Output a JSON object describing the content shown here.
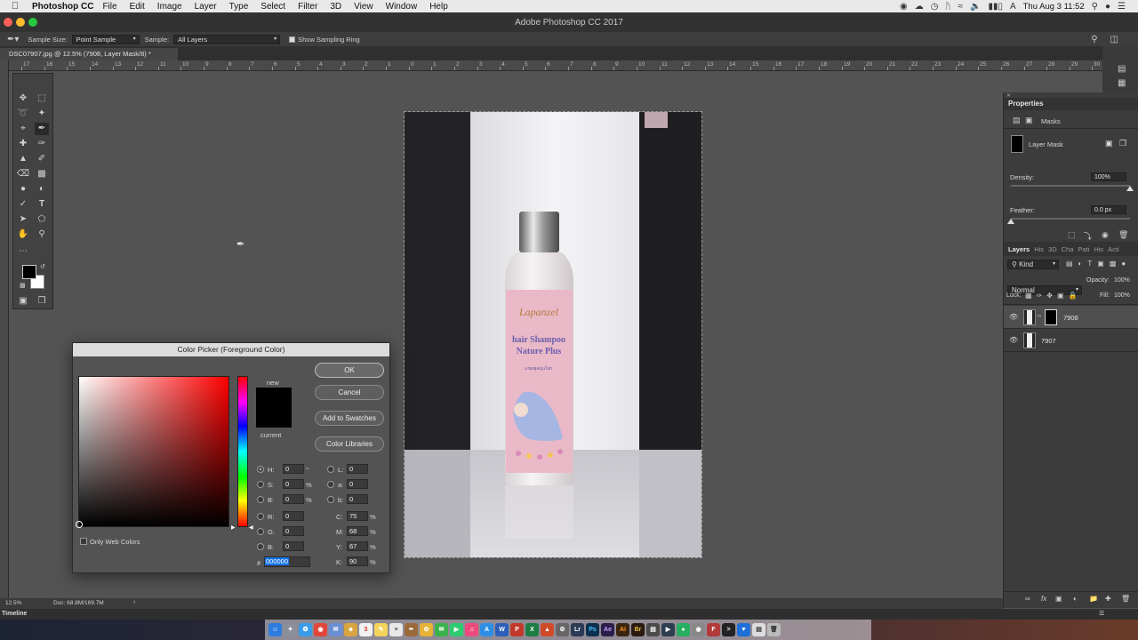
{
  "menubar": {
    "app": "Photoshop CC",
    "items": [
      "File",
      "Edit",
      "Image",
      "Layer",
      "Type",
      "Select",
      "Filter",
      "3D",
      "View",
      "Window",
      "Help"
    ],
    "clock": "Thu Aug 3  11:52"
  },
  "window": {
    "title": "Adobe Photoshop CC 2017"
  },
  "options": {
    "sample_size_label": "Sample Size:",
    "sample_size_value": "Point Sample",
    "sample_label": "Sample:",
    "sample_value": "All Layers",
    "sampling_ring_label": "Show Sampling Ring"
  },
  "document": {
    "tab_title": "DSC07907.jpg @ 12.5% (7908, Layer Mask/8) *",
    "ruler_ticks": [
      "17",
      "16",
      "15",
      "14",
      "13",
      "12",
      "11",
      "10",
      "9",
      "8",
      "7",
      "6",
      "5",
      "4",
      "3",
      "2",
      "1",
      "0",
      "1",
      "2",
      "3",
      "4",
      "5",
      "6",
      "7",
      "8",
      "9",
      "10",
      "11",
      "12",
      "13",
      "14",
      "15",
      "16",
      "17",
      "18",
      "19",
      "20",
      "21",
      "22",
      "23",
      "24",
      "25",
      "26",
      "27",
      "28",
      "29",
      "30"
    ]
  },
  "status": {
    "zoom": "12.5%",
    "doc": "Doc: 68.8M/169.7M"
  },
  "timeline": {
    "label": "Timeline"
  },
  "properties": {
    "title": "Properties",
    "masks_label": "Masks",
    "layer_mask_label": "Layer Mask",
    "density_label": "Density:",
    "density_value": "100%",
    "density_level": 1.0,
    "feather_label": "Feather:",
    "feather_value": "0.0 px",
    "feather_level": 0.0
  },
  "layers": {
    "tabs": [
      "Layers",
      "His",
      "3D",
      "Cha",
      "Pati",
      "His",
      "Acti"
    ],
    "kind_label": "Kind",
    "blend_mode": "Normal",
    "opacity_label": "Opacity:",
    "opacity_value": "100%",
    "lock_label": "Lock:",
    "fill_label": "Fill:",
    "fill_value": "100%",
    "rows": [
      {
        "name": "7908"
      },
      {
        "name": "7907"
      }
    ]
  },
  "dialog": {
    "title": "Color Picker (Foreground Color)",
    "ok": "OK",
    "cancel": "Cancel",
    "add_swatches": "Add to Swatches",
    "color_libraries": "Color Libraries",
    "new_label": "new",
    "current_label": "current",
    "only_web": "Only Web Colors",
    "fields": {
      "H": {
        "label": "H:",
        "value": "0",
        "unit": "°"
      },
      "S": {
        "label": "S:",
        "value": "0",
        "unit": "%"
      },
      "B": {
        "label": "B:",
        "value": "0",
        "unit": "%"
      },
      "R": {
        "label": "R:",
        "value": "0",
        "unit": ""
      },
      "G": {
        "label": "G:",
        "value": "0",
        "unit": ""
      },
      "Bb": {
        "label": "B:",
        "value": "0",
        "unit": ""
      },
      "L": {
        "label": "L:",
        "value": "0",
        "unit": ""
      },
      "a": {
        "label": "a:",
        "value": "0",
        "unit": ""
      },
      "b": {
        "label": "b:",
        "value": "0",
        "unit": ""
      },
      "C": {
        "label": "C:",
        "value": "75",
        "unit": "%"
      },
      "M": {
        "label": "M:",
        "value": "68",
        "unit": "%"
      },
      "Y": {
        "label": "Y:",
        "value": "67",
        "unit": "%"
      },
      "K": {
        "label": "K:",
        "value": "90",
        "unit": "%"
      }
    },
    "hex_label": "#",
    "hex_value": "000000",
    "new_color": "#000000",
    "current_color": "#000000"
  },
  "product": {
    "brand": "Lapanzel",
    "line1": "hair Shampoo",
    "line2": "Nature Plus",
    "thai": "แชมพูสมุนไพร"
  },
  "colors": {
    "accent": "#1473e6",
    "canvas_bg": "#535353"
  }
}
